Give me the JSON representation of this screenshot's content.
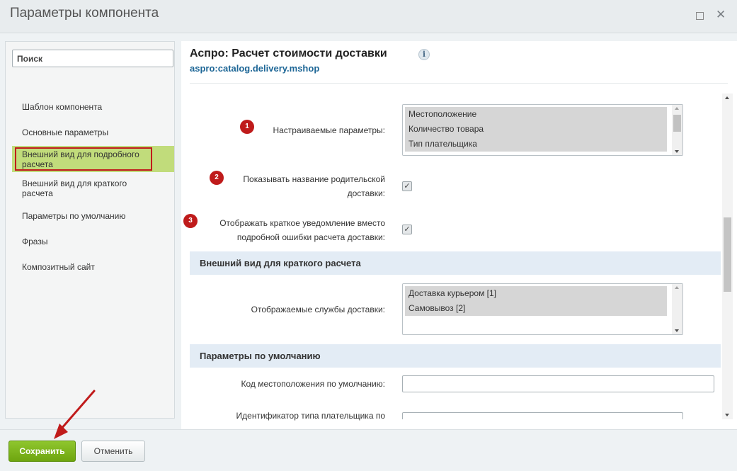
{
  "window": {
    "title": "Параметры компонента"
  },
  "sidebar": {
    "search_placeholder": "Поиск",
    "items": [
      {
        "label": "Шаблон компонента"
      },
      {
        "label": "Основные параметры"
      },
      {
        "label": "Внешний вид для подробного расчета",
        "active": true
      },
      {
        "label": "Внешний вид для краткого расчета"
      },
      {
        "label": "Параметры по умолчанию"
      },
      {
        "label": "Фразы"
      },
      {
        "label": "Композитный сайт"
      }
    ]
  },
  "component": {
    "title": "Аспро: Расчет стоимости доставки",
    "info_icon": "info-icon",
    "id": "aspro:catalog.delivery.mshop"
  },
  "params": {
    "custom": {
      "badge": "1",
      "label": "Настраиваемые параметры:",
      "options": [
        "Местоположение",
        "Количество товара",
        "Тип плательщика"
      ]
    },
    "show_parent": {
      "badge": "2",
      "label_line1": "Показывать название родительской",
      "label_line2": "доставки:",
      "checked": true
    },
    "short_notice": {
      "badge": "3",
      "label_line1": "Отображать краткое уведомление вместо",
      "label_line2": "подробной ошибки расчета доставки:",
      "checked": true
    }
  },
  "section_short": {
    "title": "Внешний вид для краткого расчета",
    "services_label": "Отображаемые службы доставки:",
    "services": [
      "Доставка курьером [1]",
      "Самовывоз [2]"
    ]
  },
  "section_defaults": {
    "title": "Параметры по умолчанию",
    "location_label": "Код местоположения по умолчанию:",
    "location_value": "",
    "payer_label_partial": "Идентификатор типа плательщика по"
  },
  "footer": {
    "save_label": "Сохранить",
    "cancel_label": "Отменить"
  },
  "colors": {
    "save_green": "#7cb518",
    "active_item": "#c1dc7b",
    "badge_red": "#bf1b1b",
    "link_blue": "#1d6696",
    "section_bg": "#e3ecf5"
  }
}
